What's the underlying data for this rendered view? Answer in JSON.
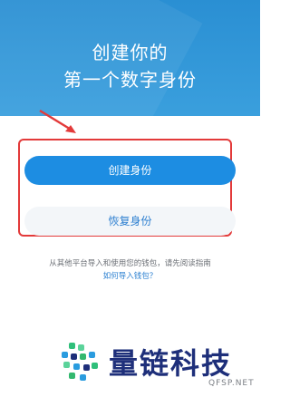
{
  "hero": {
    "title_line1": "创建你的",
    "title_line2": "第一个数字身份"
  },
  "actions": {
    "create_label": "创建身份",
    "restore_label": "恢复身份"
  },
  "help": {
    "text": "从其他平台导入和使用您的钱包，请先阅读指南",
    "link": "如何导入钱包？"
  },
  "watermark": {
    "text": "量链科技",
    "sub": "QFSP.NET"
  },
  "colors": {
    "hero": "#2a8fd3",
    "primary": "#1d8de2",
    "highlight": "#e33a3a",
    "link": "#2a7fd0"
  }
}
